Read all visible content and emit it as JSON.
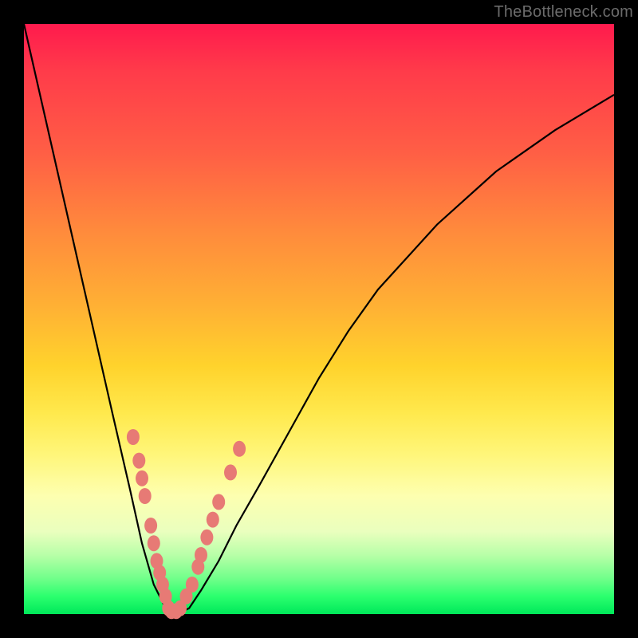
{
  "watermark": "TheBottleneck.com",
  "colors": {
    "frame": "#000000",
    "curve": "#000000",
    "bead": "#e77a75",
    "gradient_top": "#ff1a4d",
    "gradient_mid": "#ffd32c",
    "gradient_bottom": "#00e85a"
  },
  "chart_data": {
    "type": "line",
    "title": "",
    "xlabel": "",
    "ylabel": "",
    "xlim": [
      0,
      100
    ],
    "ylim": [
      0,
      100
    ],
    "x": [
      0,
      5,
      10,
      15,
      18,
      20,
      22,
      24,
      25,
      26,
      28,
      30,
      33,
      36,
      40,
      45,
      50,
      55,
      60,
      70,
      80,
      90,
      100
    ],
    "values": [
      100,
      78,
      56,
      34,
      21,
      12,
      5,
      1,
      0,
      0,
      1,
      4,
      9,
      15,
      22,
      31,
      40,
      48,
      55,
      66,
      75,
      82,
      88
    ],
    "minimum_x": 25,
    "minimum_value": 0,
    "bead_points_left": [
      {
        "x": 18.5,
        "y": 30
      },
      {
        "x": 19.5,
        "y": 26
      },
      {
        "x": 20,
        "y": 23
      },
      {
        "x": 20.5,
        "y": 20
      },
      {
        "x": 21.5,
        "y": 15
      },
      {
        "x": 22,
        "y": 12
      },
      {
        "x": 22.5,
        "y": 9
      },
      {
        "x": 23,
        "y": 7
      },
      {
        "x": 23.5,
        "y": 5
      },
      {
        "x": 24,
        "y": 3
      }
    ],
    "bead_points_bottom": [
      {
        "x": 24.5,
        "y": 1
      },
      {
        "x": 25,
        "y": 0.5
      },
      {
        "x": 25.8,
        "y": 0.5
      },
      {
        "x": 26.5,
        "y": 1
      }
    ],
    "bead_points_right": [
      {
        "x": 27.5,
        "y": 3
      },
      {
        "x": 28.5,
        "y": 5
      },
      {
        "x": 29.5,
        "y": 8
      },
      {
        "x": 30,
        "y": 10
      },
      {
        "x": 31,
        "y": 13
      },
      {
        "x": 32,
        "y": 16
      },
      {
        "x": 33,
        "y": 19
      },
      {
        "x": 35,
        "y": 24
      },
      {
        "x": 36.5,
        "y": 28
      }
    ]
  }
}
